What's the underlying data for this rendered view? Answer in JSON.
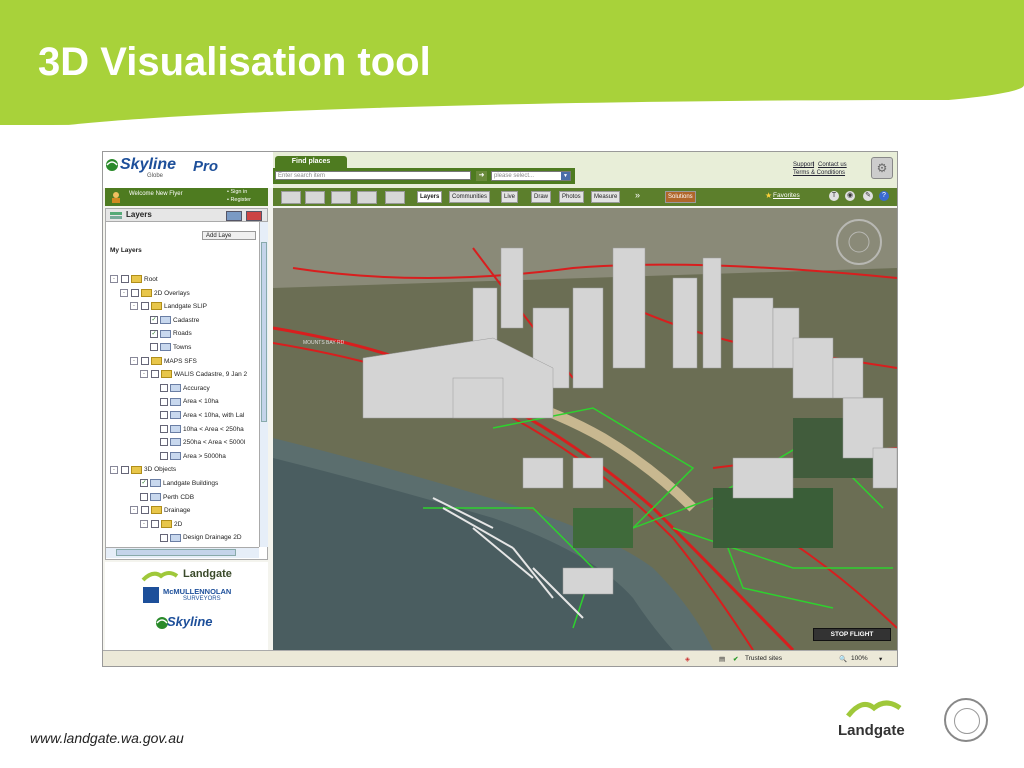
{
  "slide": {
    "title": "3D Visualisation tool",
    "footer_url": "www.landgate.wa.gov.au",
    "footer_logo": "Landgate"
  },
  "app": {
    "brand_skyline": "Skyline",
    "brand_globe": "Globe",
    "brand_pro": "Pro",
    "welcome": "Welcome New Flyer",
    "sign_in": "• Sign in",
    "register": "• Register"
  },
  "find": {
    "tab": "Find places",
    "placeholder": "Enter search item",
    "select_placeholder": "please select...",
    "support": "Support",
    "contact": "Contact us",
    "terms": "Terms & Conditions"
  },
  "toolbar": {
    "buttons": [
      "Layers",
      "Communities",
      "Live",
      "Draw",
      "Photos",
      "Measure"
    ],
    "more": "»",
    "solutions": "Solutions",
    "favorites": "Favorites"
  },
  "layers_panel": {
    "title": "Layers",
    "add_layer": "Add Laye",
    "my_layers": "My Layers",
    "tree": [
      {
        "label": "Root",
        "exp": "⊟",
        "checked": false,
        "icon": "folder"
      },
      {
        "label": "2D Overlays",
        "exp": "⊟",
        "checked": false,
        "icon": "folder"
      },
      {
        "label": "Landgate SLIP",
        "exp": "⊟",
        "checked": false,
        "icon": "folder"
      },
      {
        "label": "Cadastre",
        "exp": "",
        "checked": true,
        "icon": "layer"
      },
      {
        "label": "Roads",
        "exp": "",
        "checked": true,
        "icon": "layer"
      },
      {
        "label": "Towns",
        "exp": "",
        "checked": false,
        "icon": "layer"
      },
      {
        "label": "MAPS SFS",
        "exp": "⊟",
        "checked": false,
        "icon": "folder"
      },
      {
        "label": "WALIS Cadastre, 9 Jan 2",
        "exp": "⊟",
        "checked": false,
        "icon": "folder"
      },
      {
        "label": "Accuracy",
        "exp": "",
        "checked": false,
        "icon": "layer"
      },
      {
        "label": "Area < 10ha",
        "exp": "",
        "checked": false,
        "icon": "layer"
      },
      {
        "label": "Area < 10ha, with Lal",
        "exp": "",
        "checked": false,
        "icon": "layer"
      },
      {
        "label": "10ha < Area < 250ha",
        "exp": "",
        "checked": false,
        "icon": "layer"
      },
      {
        "label": "250ha < Area < 5000l",
        "exp": "",
        "checked": false,
        "icon": "layer"
      },
      {
        "label": "Area > 5000ha",
        "exp": "",
        "checked": false,
        "icon": "layer"
      },
      {
        "label": "3D Objects",
        "exp": "⊟",
        "checked": false,
        "icon": "folder"
      },
      {
        "label": "Landgate Buildings",
        "exp": "",
        "checked": true,
        "icon": "layer"
      },
      {
        "label": "Perth CDB",
        "exp": "",
        "checked": false,
        "icon": "layer"
      },
      {
        "label": "Drainage",
        "exp": "⊟",
        "checked": false,
        "icon": "folder"
      },
      {
        "label": "2D",
        "exp": "⊟",
        "checked": false,
        "icon": "folder"
      },
      {
        "label": "Design Drainage 2D",
        "exp": "",
        "checked": false,
        "icon": "layer"
      }
    ]
  },
  "sponsors": {
    "landgate": "Landgate",
    "mcmullen": "McMULLENNOLAN",
    "surveyors": "SURVEYORS",
    "skyline": "Skyline"
  },
  "map": {
    "stop_flight": "STOP FLIGHT",
    "road_label": "MOUNTS BAY RD"
  },
  "status": {
    "trusted": "Trusted sites",
    "zoom": "100%"
  },
  "colors": {
    "banner": "#a8d23a",
    "app_green": "#4e7b20",
    "road_red": "#d81e1e",
    "cadastre_green": "#2ed12e"
  }
}
